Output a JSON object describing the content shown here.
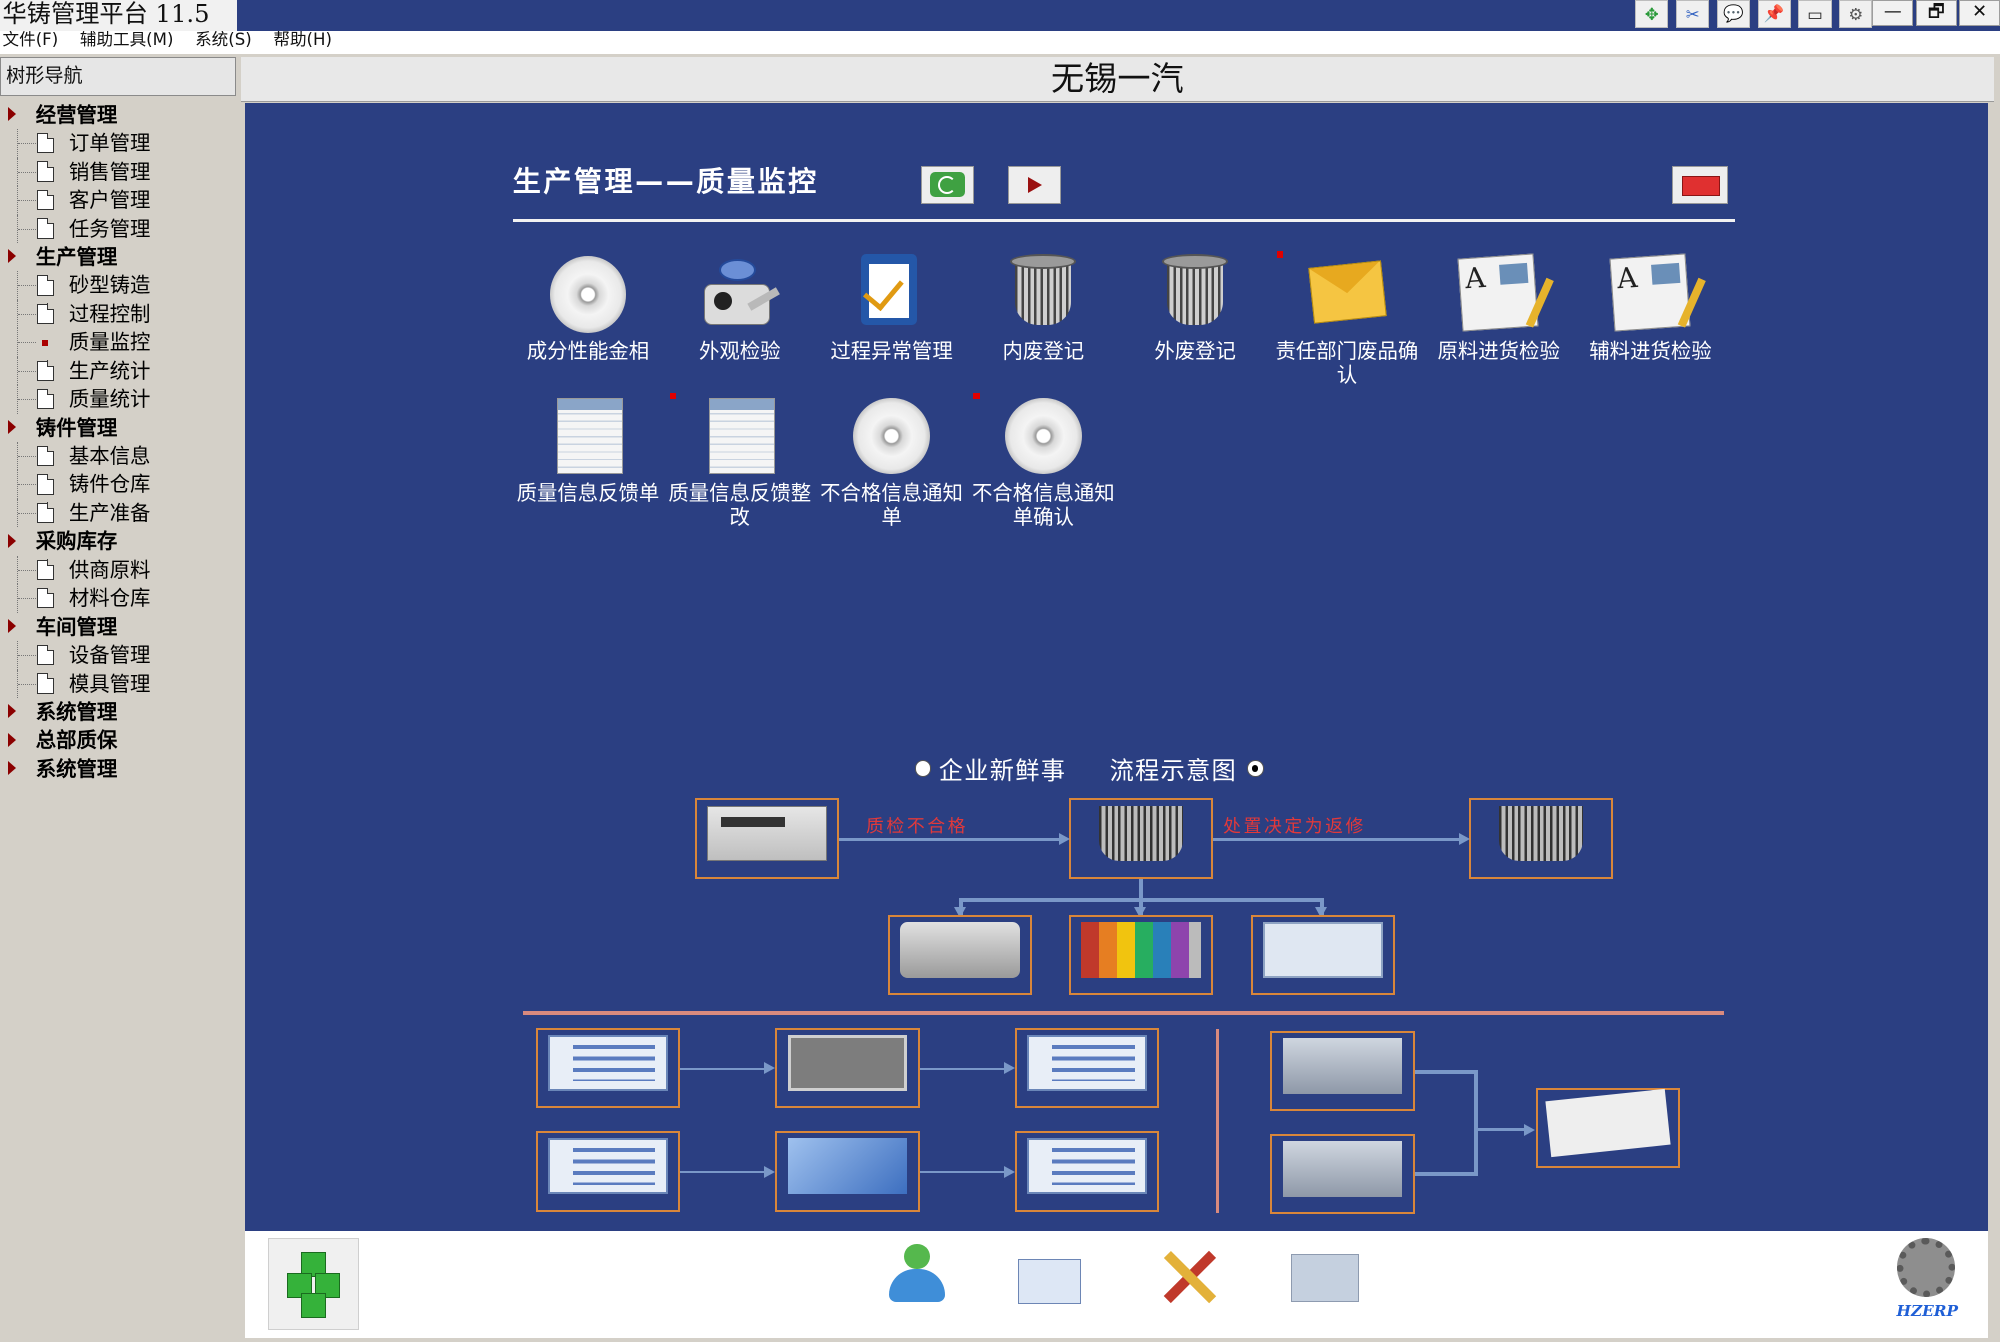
{
  "window": {
    "title": "华铸管理平台 11.5",
    "toolbar_icons": [
      "move-icon",
      "scissors-icon",
      "chat-icon",
      "pin-icon",
      "window-icon",
      "settings-icon"
    ],
    "controls": [
      "—",
      "🗗",
      "✕"
    ]
  },
  "menu": [
    "文件(F)",
    "辅助工具(M)",
    "系统(S)",
    "帮助(H)"
  ],
  "sidebar": {
    "header": "树形导航",
    "groups": [
      {
        "label": "经营管理",
        "items": [
          "订单管理",
          "销售管理",
          "客户管理",
          "任务管理"
        ]
      },
      {
        "label": "生产管理",
        "items": [
          "砂型铸造",
          "过程控制",
          "质量监控",
          "生产统计",
          "质量统计"
        ]
      },
      {
        "label": "铸件管理",
        "items": [
          "基本信息",
          "铸件仓库",
          "生产准备"
        ]
      },
      {
        "label": "采购库存",
        "items": [
          "供商原料",
          "材料仓库"
        ]
      },
      {
        "label": "车间管理",
        "items": [
          "设备管理",
          "模具管理"
        ]
      },
      {
        "label": "系统管理",
        "items": []
      },
      {
        "label": "总部质保",
        "items": []
      },
      {
        "label": "系统管理",
        "items": []
      }
    ],
    "selected": "质量监控"
  },
  "main": {
    "company": "无锡一汽",
    "section_title": "生产管理——质量监控",
    "apps": [
      {
        "label": "成分性能金相",
        "icon": "disc-icon",
        "flag": false
      },
      {
        "label": "外观检验",
        "icon": "inspection-icon",
        "flag": false
      },
      {
        "label": "过程异常管理",
        "icon": "clipboard-check-icon",
        "flag": false
      },
      {
        "label": "内废登记",
        "icon": "waste-bin-icon",
        "flag": false
      },
      {
        "label": "外废登记",
        "icon": "waste-bin-icon",
        "flag": false
      },
      {
        "label": "责任部门废品确认",
        "icon": "envelope-icon",
        "flag": true
      },
      {
        "label": "原料进货检验",
        "icon": "newspaper-icon",
        "flag": false
      },
      {
        "label": "辅料进货检验",
        "icon": "newspaper-icon",
        "flag": false
      },
      {
        "label": "质量信息反馈单",
        "icon": "document-icon",
        "flag": false
      },
      {
        "label": "质量信息反馈整改",
        "icon": "document-icon",
        "flag": true
      },
      {
        "label": "不合格信息通知单",
        "icon": "disc-icon",
        "flag": false
      },
      {
        "label": "不合格信息通知单确认",
        "icon": "disc-icon",
        "flag": true
      }
    ],
    "tabs": [
      {
        "label": "企业新鲜事",
        "selected": false
      },
      {
        "label": "流程示意图",
        "selected": true
      }
    ],
    "flow_labels": {
      "qc_fail": "质检不合格",
      "dispose_return": "处置决定为返修"
    }
  },
  "bottom": {
    "brand": "HZERP"
  }
}
